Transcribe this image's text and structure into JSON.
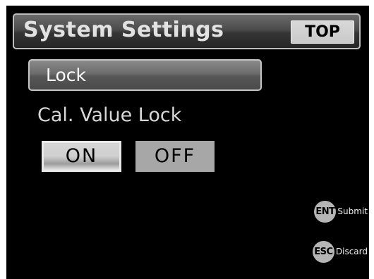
{
  "header": {
    "title": "System Settings",
    "top_label": "TOP"
  },
  "section": {
    "title": "Lock"
  },
  "setting": {
    "label": "Cal. Value Lock",
    "on_label": "ON",
    "off_label": "OFF",
    "selected": "ON"
  },
  "hints": {
    "submit_key": "ENT",
    "submit_label": "Submit",
    "discard_key": "ESC",
    "discard_label": "Discard"
  },
  "colors": {
    "screen_background": "#000000",
    "button_gray": "#a7a7a7",
    "text_light": "#d7d7d7"
  }
}
